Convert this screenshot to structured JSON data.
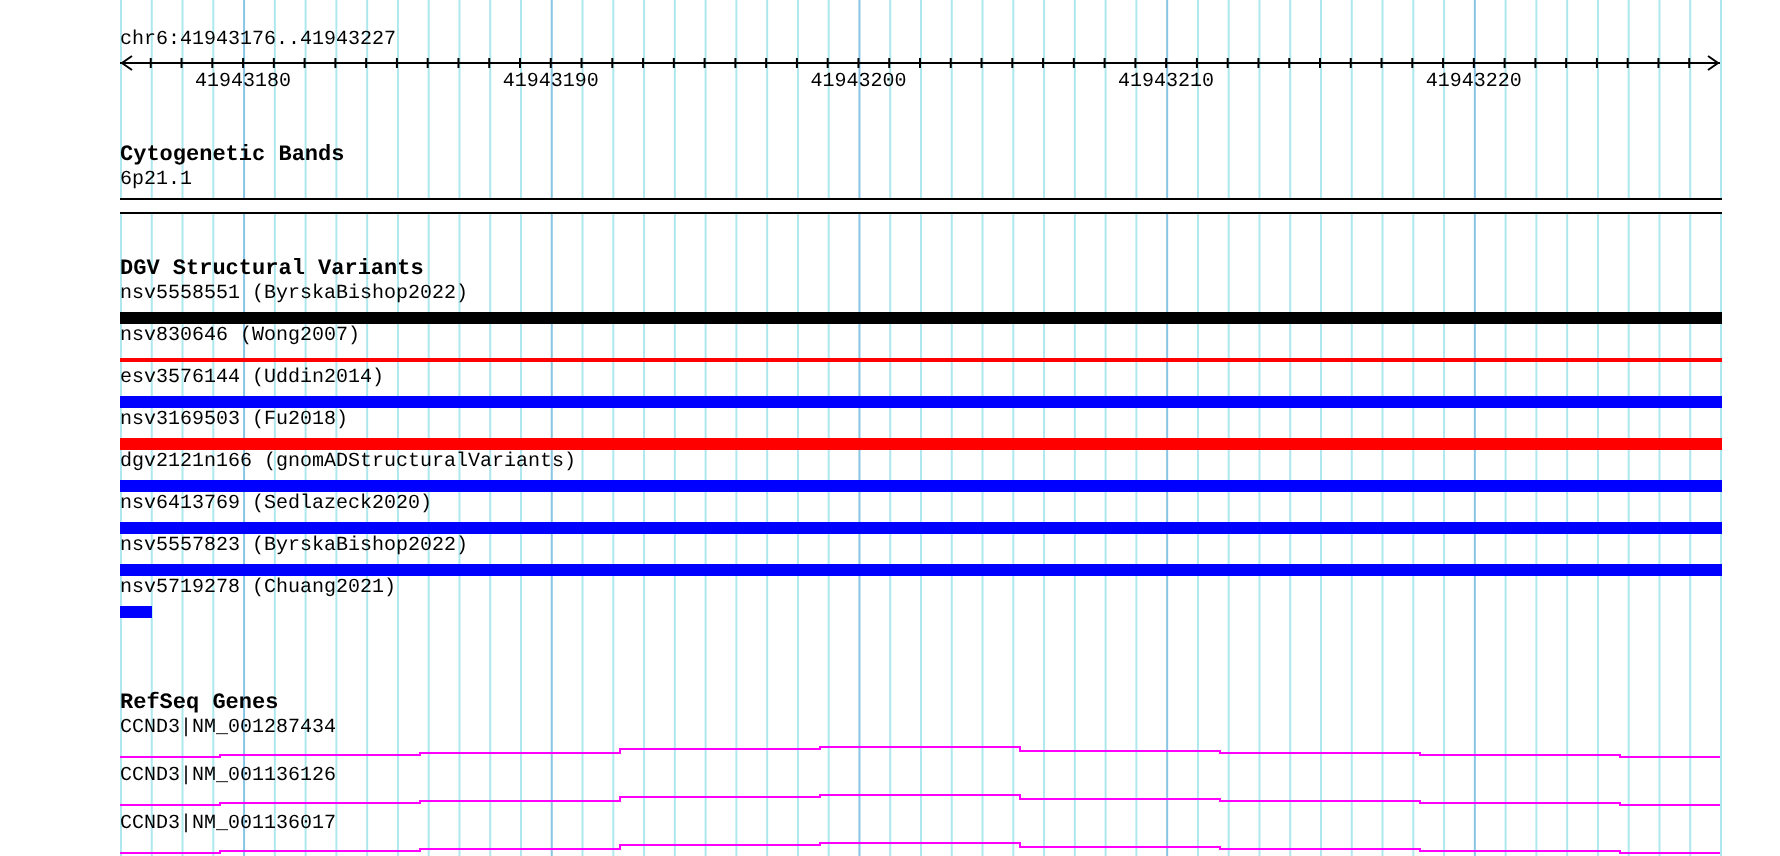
{
  "ruler": {
    "title": "chr6:41943176..41943227",
    "ticks": [
      "41943180",
      "41943190",
      "41943200",
      "41943210",
      "41943220"
    ]
  },
  "tracks": [
    {
      "title": "Cytogenetic Bands",
      "kind": "bands",
      "features": [
        {
          "label": "6p21.1",
          "kind": "band"
        }
      ]
    },
    {
      "title": "DGV Structural Variants",
      "kind": "variants",
      "features": [
        {
          "label": "nsv5558551 (ByrskaBishop2022)",
          "kind": "bar",
          "color": "#000000"
        },
        {
          "label": "nsv830646 (Wong2007)",
          "kind": "line",
          "color": "#ff0000"
        },
        {
          "label": "esv3576144 (Uddin2014)",
          "kind": "bar",
          "color": "#0000ff"
        },
        {
          "label": "nsv3169503 (Fu2018)",
          "kind": "bar",
          "color": "#ff0000"
        },
        {
          "label": "dgv2121n166 (gnomADStructuralVariants)",
          "kind": "bar",
          "color": "#0000ff"
        },
        {
          "label": "nsv6413769 (Sedlazeck2020)",
          "kind": "bar",
          "color": "#0000ff"
        },
        {
          "label": "nsv5557823 (ByrskaBishop2022)",
          "kind": "bar",
          "color": "#0000ff"
        },
        {
          "label": "nsv5719278 (Chuang2021)",
          "kind": "stub",
          "color": "#0000ff"
        }
      ]
    },
    {
      "title": "RefSeq Genes",
      "kind": "genes",
      "features": [
        {
          "label": "CCND3|NM_001287434",
          "kind": "gene"
        },
        {
          "label": "CCND3|NM_001136126",
          "kind": "gene"
        },
        {
          "label": "CCND3|NM_001136017",
          "kind": "gene"
        }
      ]
    }
  ]
}
